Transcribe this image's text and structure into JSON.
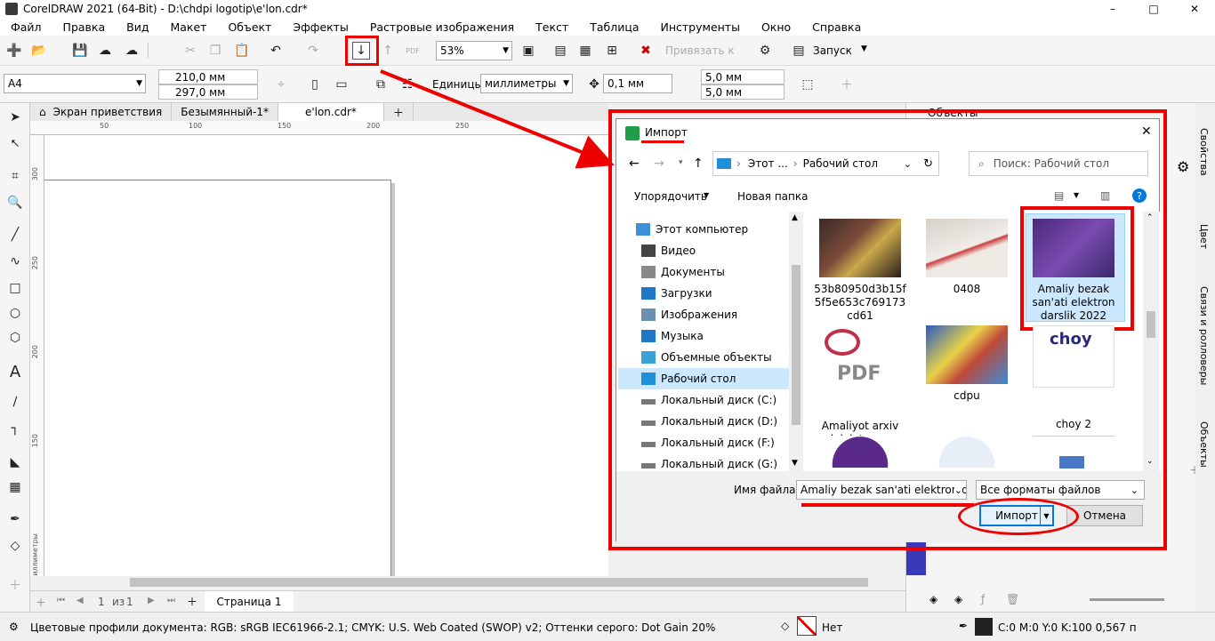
{
  "window": {
    "title": "CorelDRAW 2021 (64-Bit) - D:\\chdpi logotip\\e'lon.cdr*"
  },
  "menu": [
    "Файл",
    "Правка",
    "Вид",
    "Макет",
    "Объект",
    "Эффекты",
    "Растровые изображения",
    "Текст",
    "Таблица",
    "Инструменты",
    "Окно",
    "Справка"
  ],
  "toolbar": {
    "zoom": "53%",
    "snap_label": "Привязать к",
    "launch_label": "Запуск"
  },
  "propbar": {
    "page_size": "A4",
    "width": "210,0 мм",
    "height": "297,0 мм",
    "units_label": "Единицы:",
    "units_value": "миллиметры",
    "nudge": "0,1 мм",
    "dup_x": "5,0 мм",
    "dup_y": "5,0 мм"
  },
  "doc_tabs": [
    {
      "label": "Экран приветствия"
    },
    {
      "label": "Безымянный-1*"
    },
    {
      "label": "e'lon.cdr*"
    }
  ],
  "ruler": {
    "h_ticks": [
      "50",
      "100",
      "150",
      "200",
      "250"
    ],
    "v_ticks": [
      "300",
      "250",
      "200",
      "150"
    ],
    "unit": "миллиметры"
  },
  "page_nav": {
    "position": "1",
    "of_label": "из",
    "total": "1",
    "page_tab": "Страница 1"
  },
  "status": {
    "color_profiles": "Цветовые профили документа: RGB: sRGB IEC61966-2.1; CMYK: U.S. Web Coated (SWOP) v2; Оттенки серого: Dot Gain 20%",
    "fill_none": "Нет",
    "outline_info": "C:0 M:0 Y:0 K:100  0,567 п"
  },
  "right_panel": {
    "title": "Объекты"
  },
  "side_tabs": [
    "Свойства",
    "Цвет",
    "Связи и ролловеры",
    "Объекты"
  ],
  "dialog": {
    "title": "Импорт",
    "address": {
      "part1": "Этот ...",
      "part2": "Рабочий стол"
    },
    "search_placeholder": "Поиск: Рабочий стол",
    "organize": "Упорядочить",
    "new_folder": "Новая папка",
    "nav_tree": [
      {
        "label": "Этот компьютер",
        "icon": "computer-icon",
        "indent": 0,
        "selected": false
      },
      {
        "label": "Видео",
        "icon": "video-folder-icon",
        "indent": 1,
        "selected": false
      },
      {
        "label": "Документы",
        "icon": "documents-folder-icon",
        "indent": 1,
        "selected": false
      },
      {
        "label": "Загрузки",
        "icon": "downloads-folder-icon",
        "indent": 1,
        "selected": false
      },
      {
        "label": "Изображения",
        "icon": "pictures-folder-icon",
        "indent": 1,
        "selected": false
      },
      {
        "label": "Музыка",
        "icon": "music-folder-icon",
        "indent": 1,
        "selected": false
      },
      {
        "label": "Объемные объекты",
        "icon": "3d-objects-folder-icon",
        "indent": 1,
        "selected": false
      },
      {
        "label": "Рабочий стол",
        "icon": "desktop-folder-icon",
        "indent": 1,
        "selected": true
      },
      {
        "label": "Локальный диск (C:)",
        "icon": "drive-icon",
        "indent": 1,
        "selected": false
      },
      {
        "label": "Локальный диск (D:)",
        "icon": "drive-icon",
        "indent": 1,
        "selected": false
      },
      {
        "label": "Локальный диск (F:)",
        "icon": "drive-icon",
        "indent": 1,
        "selected": false
      },
      {
        "label": "Локальный диск (G:)",
        "icon": "drive-icon",
        "indent": 1,
        "selected": false
      }
    ],
    "files": [
      {
        "name": "53b80950d3b15f5f5e653c769173cd61",
        "kind": "photo-still-life",
        "selected": false
      },
      {
        "name": "0408",
        "kind": "certificate-image",
        "selected": false
      },
      {
        "name": "Amaliy bezak san'ati elektron darslik 2022",
        "kind": "purple-slide",
        "selected": true
      },
      {
        "name": "Amaliyot arxiv dalolatnoma",
        "kind": "pdf-file",
        "selected": false
      },
      {
        "name": "cdpu",
        "kind": "paint-brushes-image",
        "selected": false
      },
      {
        "name": "choy 2",
        "kind": "choy-logo",
        "selected": false
      },
      {
        "name": "",
        "kind": "purple-circle-logo",
        "selected": false
      },
      {
        "name": "",
        "kind": "emblem-logo",
        "selected": false
      },
      {
        "name": "",
        "kind": "book-icon",
        "selected": false
      }
    ],
    "filename_label": "Имя файла:",
    "filename_value": "Amaliy bezak san'ati elektron da",
    "filter_value": "Все форматы файлов",
    "import_button": "Импорт",
    "cancel_button": "Отмена"
  },
  "colors": {
    "annotation_red": "#e00000",
    "selection_blue": "#cce8ff",
    "accent_blue": "#0078d7",
    "toolbar_bg": "#f5f5f5"
  }
}
